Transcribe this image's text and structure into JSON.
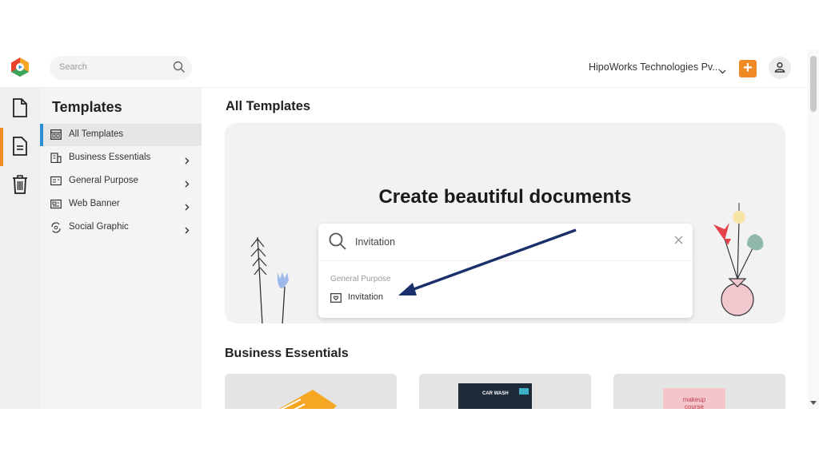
{
  "topbar": {
    "search_placeholder": "Search",
    "organization": "HipoWorks Technologies Pv...",
    "add_button": "+",
    "brand_color": "#f08a24"
  },
  "rail": {
    "items": [
      {
        "icon": "document-icon",
        "active": true
      },
      {
        "icon": "file-text-icon",
        "active": false
      },
      {
        "icon": "trash-icon",
        "active": false
      }
    ]
  },
  "sidebar": {
    "title": "Templates",
    "items": [
      {
        "label": "All Templates",
        "icon": "grid-icon",
        "active": true
      },
      {
        "label": "Business Essentials",
        "icon": "building-icon"
      },
      {
        "label": "General Purpose",
        "icon": "card-icon"
      },
      {
        "label": "Web Banner",
        "icon": "banner-icon"
      },
      {
        "label": "Social Graphic",
        "icon": "social-icon"
      }
    ]
  },
  "main": {
    "title": "All Templates",
    "hero_title": "Create beautiful documents",
    "search_value": "Invitation",
    "result_category": "General Purpose",
    "result_label": "Invitation",
    "section_title": "Business Essentials",
    "cards": [
      {
        "text": "CAR WASH"
      },
      {
        "text": "makeup course"
      }
    ]
  }
}
